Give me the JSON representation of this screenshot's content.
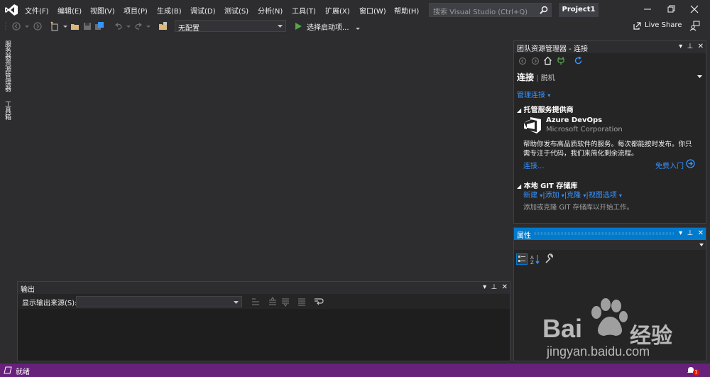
{
  "menu": [
    {
      "label": "文件(F)"
    },
    {
      "label": "编辑(E)"
    },
    {
      "label": "视图(V)"
    },
    {
      "label": "项目(P)"
    },
    {
      "label": "生成(B)"
    },
    {
      "label": "调试(D)"
    },
    {
      "label": "测试(S)"
    },
    {
      "label": "分析(N)"
    },
    {
      "label": "工具(T)"
    },
    {
      "label": "扩展(X)"
    },
    {
      "label": "窗口(W)"
    },
    {
      "label": "帮助(H)"
    }
  ],
  "search": {
    "placeholder": "搜索 Visual Studio (Ctrl+Q)"
  },
  "project_title": "Project1",
  "toolbar": {
    "config_value": "无配置",
    "start_label": "选择启动项...",
    "live_share_label": "Live Share"
  },
  "left_tabs": {
    "server_explorer": "服务器资源管理器",
    "toolbox": "工具箱"
  },
  "team_explorer": {
    "title": "团队资源管理器 - 连接",
    "connect_title": "连接",
    "offline": "脱机",
    "manage_connections": "管理连接",
    "hosted_section": "托管服务提供商",
    "azure_name": "Azure DevOps",
    "azure_company": "Microsoft Corporation",
    "azure_desc_line1": "帮助你发布高品质软件的服务。每次都能按时发布。你只",
    "azure_desc_line2": "需专注于代码，我们来简化剩余流程。",
    "connect_link": "连接...",
    "free_start_link": "免费入门",
    "local_git_section": "本地 GIT 存储库",
    "git_actions": {
      "new": "新建",
      "add": "添加",
      "clone": "克隆",
      "view_options": "视图选项"
    },
    "git_hint": "添加或克隆 GIT 存储库以开始工作。"
  },
  "properties": {
    "title": "属性"
  },
  "output": {
    "title": "输出",
    "source_label": "显示输出来源(S):",
    "source_value": ""
  },
  "status": {
    "text": "就绪",
    "notification_count": "1"
  },
  "watermark": {
    "brand": "Bai",
    "brand_cn": "经验",
    "url": "jingyan.baidu.com"
  },
  "colors": {
    "accent": "#007acc",
    "status_bar": "#68217a",
    "link": "#3794ff",
    "background": "#2d2d30"
  }
}
